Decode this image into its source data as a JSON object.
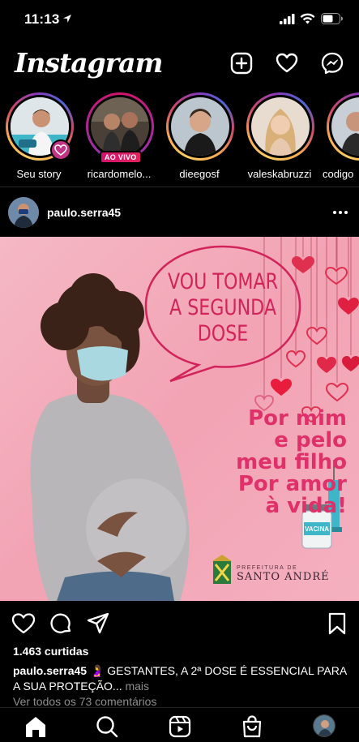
{
  "status_bar": {
    "time": "11:13"
  },
  "header": {
    "logo": "Instagram"
  },
  "stories": [
    {
      "label": "Seu story",
      "live": false
    },
    {
      "label": "ricardomelo...",
      "live": true,
      "live_text": "AO VIVO"
    },
    {
      "label": "dieegosf",
      "live": false
    },
    {
      "label": "valeskabruzzi",
      "live": false
    },
    {
      "label": "codigo",
      "live": false
    }
  ],
  "post": {
    "username": "paulo.serra45",
    "image": {
      "speech_lines": [
        "VOU TOMAR",
        "A SEGUNDA",
        "DOSE"
      ],
      "slogan_lines": [
        "Por mim",
        "e pelo",
        "meu filho",
        "Por amor",
        "à vida!"
      ],
      "vaccine_label": "VACINA",
      "prefeitura_small": "PREFEITURA DE",
      "prefeitura_city": "SANTO ANDRÉ"
    },
    "likes": "1.463 curtidas",
    "caption_user": "paulo.serra45",
    "caption_text": " 🤰 GESTANTES, A 2ª DOSE É ESSENCIAL PARA A SUA PROTEÇÃO...",
    "caption_more": " mais",
    "comments_link": "Ver todos os 73 comentários"
  },
  "colors": {
    "accent_pink": "#d2235a",
    "background": "#000000"
  }
}
